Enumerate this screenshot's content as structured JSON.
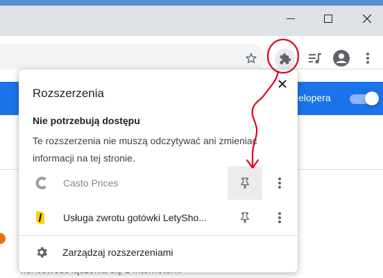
{
  "popup": {
    "title": "Rozszerzenia",
    "section_heading": "Nie potrzebują dostępu",
    "description_line1": "Te rozszerzenia nie muszą odczytywać ani zmieniać",
    "description_line2": "informacji na tej stronie.",
    "extensions": [
      {
        "name": "Casto Prices",
        "icon": "casto-c-icon",
        "enabled": false
      },
      {
        "name": "Usługa zwrotu gotówki LetySho...",
        "icon": "letyshops-icon",
        "enabled": true
      }
    ],
    "manage_label": "Zarządzaj rozszerzeniami"
  },
  "page": {
    "band_text": "elopera",
    "bottom_text": "końcowość łączenia się z Internetem."
  },
  "colors": {
    "accent": "#1a73e8",
    "annotation": "#e0001b",
    "titlebar": "#dee1e6"
  },
  "icons": [
    "minimize-icon",
    "maximize-icon",
    "close-window-icon",
    "star-icon",
    "extensions-puzzle-icon",
    "media-queue-icon",
    "profile-icon",
    "menu-icon",
    "close-icon",
    "pin-icon",
    "more-vert-icon",
    "gear-icon"
  ]
}
